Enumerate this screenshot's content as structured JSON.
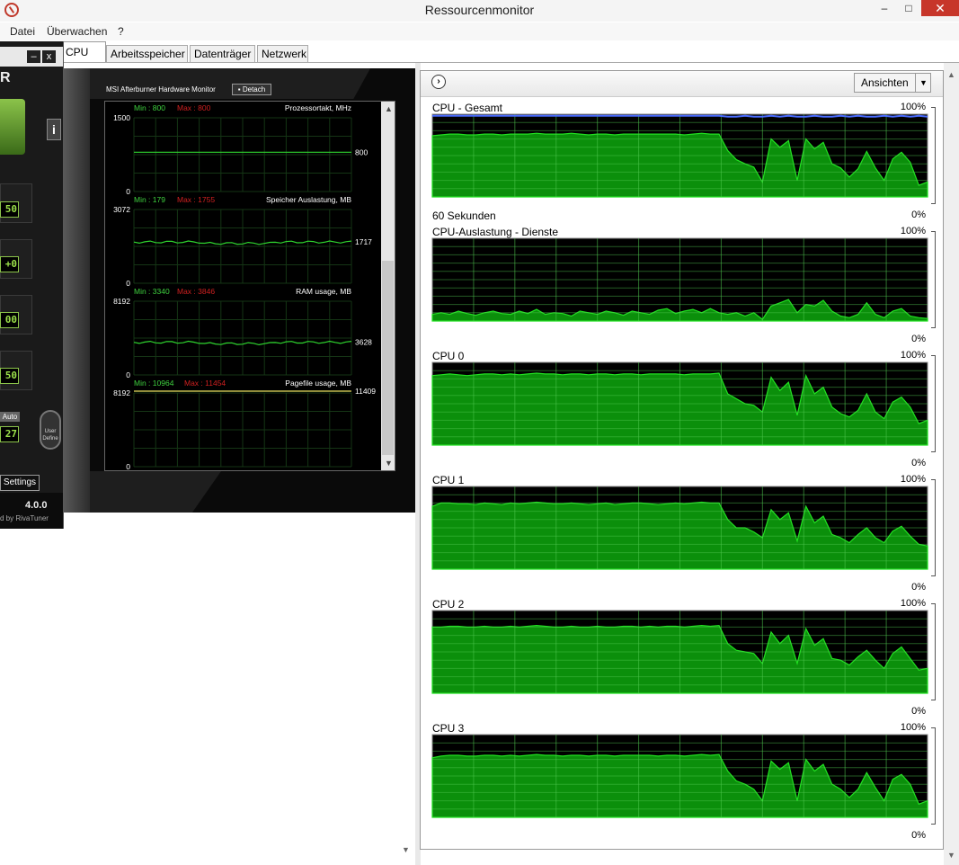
{
  "window": {
    "title": "Ressourcenmonitor",
    "min_glyph": "–",
    "max_glyph": "□",
    "close_glyph": "✕"
  },
  "menu": [
    "Datei",
    "Überwachen",
    "?"
  ],
  "tabs": [
    "CPU",
    "Arbeitsspeicher",
    "Datenträger",
    "Netzwerk"
  ],
  "afterburner": {
    "minimize_glyph": "–",
    "close_glyph": "x",
    "logo_text": "R",
    "info_glyph": "i",
    "values": [
      "50",
      "+0",
      "00",
      "50"
    ],
    "auto_label": "Auto",
    "fan_value": "27",
    "user_define_line1": "User",
    "user_define_line2": "Define",
    "settings_label": "Settings",
    "version": "4.0.0",
    "by_text": "d by RivaTuner"
  },
  "hardware_monitor": {
    "title": "MSI Afterburner Hardware Monitor",
    "detach_label": "▪ Detach",
    "graphs": [
      {
        "name": "Prozessortakt, MHz",
        "min_label": "Min : 800",
        "max_label": "Max : 800",
        "ymax": "1500",
        "ymin": "0",
        "current": "800",
        "level": 0.533,
        "line_color": "#2fd52f"
      },
      {
        "name": "Speicher Auslastung, MB",
        "min_label": "Min : 179",
        "max_label": "Max : 1755",
        "ymax": "3072",
        "ymin": "0",
        "current": "1717",
        "level": 0.559,
        "line_color": "#2fd52f"
      },
      {
        "name": "RAM usage, MB",
        "min_label": "Min : 3340",
        "max_label": "Max : 3846",
        "ymax": "8192",
        "ymin": "0",
        "current": "3628",
        "level": 0.443,
        "line_color": "#2fd52f"
      },
      {
        "name": "Pagefile usage, MB",
        "min_label": "Min : 10964",
        "max_label": "Max : 11454",
        "ymax": "8192",
        "ymin": "0",
        "current": "11409",
        "level": 1.0,
        "line_color": "#e8e060"
      }
    ]
  },
  "resource_monitor": {
    "views_label": "Ansichten",
    "caret": "▼",
    "expand_glyph": "›",
    "time_label": "60 Sekunden",
    "pct_top": "100%",
    "pct_bottom": "0%",
    "charts": [
      {
        "title": "CPU - Gesamt",
        "values": [
          0.74,
          0.75,
          0.76,
          0.76,
          0.75,
          0.75,
          0.76,
          0.76,
          0.75,
          0.76,
          0.76,
          0.76,
          0.77,
          0.76,
          0.76,
          0.76,
          0.77,
          0.76,
          0.75,
          0.76,
          0.76,
          0.75,
          0.76,
          0.76,
          0.76,
          0.76,
          0.76,
          0.76,
          0.76,
          0.75,
          0.76,
          0.77,
          0.76,
          0.76,
          0.56,
          0.45,
          0.4,
          0.36,
          0.18,
          0.7,
          0.6,
          0.68,
          0.2,
          0.7,
          0.58,
          0.66,
          0.4,
          0.35,
          0.24,
          0.34,
          0.55,
          0.35,
          0.2,
          0.46,
          0.54,
          0.42,
          0.14,
          0.18
        ],
        "line_values": [
          0.98,
          0.98,
          0.98,
          0.98,
          0.98,
          0.98,
          0.98,
          0.98,
          0.98,
          0.98,
          0.98,
          0.98,
          0.98,
          0.98,
          0.98,
          0.98,
          0.98,
          0.98,
          0.98,
          0.98,
          0.98,
          0.98,
          0.98,
          0.98,
          0.98,
          0.98,
          0.98,
          0.98,
          0.98,
          0.98,
          0.98,
          0.98,
          0.98,
          0.98,
          0.97,
          0.97,
          0.98,
          0.97,
          0.97,
          0.98,
          0.97,
          0.98,
          0.97,
          0.97,
          0.98,
          0.97,
          0.97,
          0.98,
          0.97,
          0.98,
          0.97,
          0.97,
          0.98,
          0.97,
          0.98,
          0.97,
          0.98,
          0.97
        ]
      },
      {
        "title": "CPU-Auslastung - Dienste",
        "values": [
          0.08,
          0.1,
          0.08,
          0.12,
          0.09,
          0.07,
          0.1,
          0.12,
          0.09,
          0.08,
          0.12,
          0.09,
          0.14,
          0.08,
          0.1,
          0.09,
          0.06,
          0.12,
          0.1,
          0.08,
          0.12,
          0.1,
          0.07,
          0.12,
          0.1,
          0.08,
          0.13,
          0.15,
          0.09,
          0.12,
          0.14,
          0.1,
          0.15,
          0.1,
          0.08,
          0.1,
          0.06,
          0.1,
          0.02,
          0.18,
          0.22,
          0.26,
          0.1,
          0.2,
          0.18,
          0.25,
          0.12,
          0.06,
          0.04,
          0.08,
          0.22,
          0.08,
          0.04,
          0.12,
          0.15,
          0.06,
          0.04,
          0.03
        ]
      },
      {
        "title": "CPU 0",
        "values": [
          0.84,
          0.85,
          0.86,
          0.85,
          0.84,
          0.85,
          0.86,
          0.86,
          0.85,
          0.86,
          0.85,
          0.86,
          0.87,
          0.86,
          0.86,
          0.85,
          0.86,
          0.86,
          0.85,
          0.86,
          0.86,
          0.85,
          0.86,
          0.86,
          0.85,
          0.86,
          0.86,
          0.86,
          0.86,
          0.85,
          0.86,
          0.86,
          0.86,
          0.87,
          0.62,
          0.56,
          0.5,
          0.48,
          0.4,
          0.82,
          0.66,
          0.76,
          0.36,
          0.84,
          0.62,
          0.7,
          0.46,
          0.38,
          0.34,
          0.42,
          0.62,
          0.4,
          0.32,
          0.52,
          0.58,
          0.46,
          0.26,
          0.3
        ]
      },
      {
        "title": "CPU 1",
        "values": [
          0.76,
          0.8,
          0.8,
          0.79,
          0.79,
          0.78,
          0.8,
          0.79,
          0.78,
          0.8,
          0.79,
          0.8,
          0.81,
          0.8,
          0.79,
          0.79,
          0.8,
          0.79,
          0.78,
          0.79,
          0.8,
          0.78,
          0.79,
          0.8,
          0.8,
          0.79,
          0.78,
          0.79,
          0.8,
          0.79,
          0.8,
          0.81,
          0.8,
          0.8,
          0.6,
          0.5,
          0.5,
          0.45,
          0.38,
          0.72,
          0.6,
          0.68,
          0.34,
          0.76,
          0.56,
          0.64,
          0.42,
          0.38,
          0.32,
          0.42,
          0.5,
          0.38,
          0.32,
          0.46,
          0.52,
          0.4,
          0.3,
          0.28
        ]
      },
      {
        "title": "CPU 2",
        "values": [
          0.8,
          0.8,
          0.81,
          0.81,
          0.8,
          0.8,
          0.81,
          0.8,
          0.8,
          0.81,
          0.8,
          0.81,
          0.82,
          0.81,
          0.8,
          0.8,
          0.81,
          0.8,
          0.8,
          0.81,
          0.8,
          0.8,
          0.81,
          0.81,
          0.8,
          0.81,
          0.8,
          0.81,
          0.81,
          0.8,
          0.81,
          0.82,
          0.81,
          0.82,
          0.6,
          0.52,
          0.5,
          0.48,
          0.36,
          0.74,
          0.6,
          0.7,
          0.36,
          0.78,
          0.58,
          0.66,
          0.42,
          0.4,
          0.34,
          0.44,
          0.52,
          0.4,
          0.3,
          0.48,
          0.56,
          0.42,
          0.28,
          0.3
        ]
      },
      {
        "title": "CPU 3",
        "values": [
          0.72,
          0.74,
          0.75,
          0.75,
          0.74,
          0.74,
          0.75,
          0.75,
          0.74,
          0.75,
          0.74,
          0.75,
          0.76,
          0.75,
          0.75,
          0.74,
          0.75,
          0.75,
          0.74,
          0.75,
          0.75,
          0.74,
          0.75,
          0.75,
          0.75,
          0.75,
          0.74,
          0.75,
          0.75,
          0.74,
          0.75,
          0.76,
          0.75,
          0.76,
          0.56,
          0.44,
          0.4,
          0.34,
          0.2,
          0.68,
          0.58,
          0.66,
          0.2,
          0.7,
          0.56,
          0.64,
          0.4,
          0.34,
          0.24,
          0.34,
          0.54,
          0.36,
          0.2,
          0.46,
          0.52,
          0.4,
          0.16,
          0.2
        ]
      }
    ]
  }
}
